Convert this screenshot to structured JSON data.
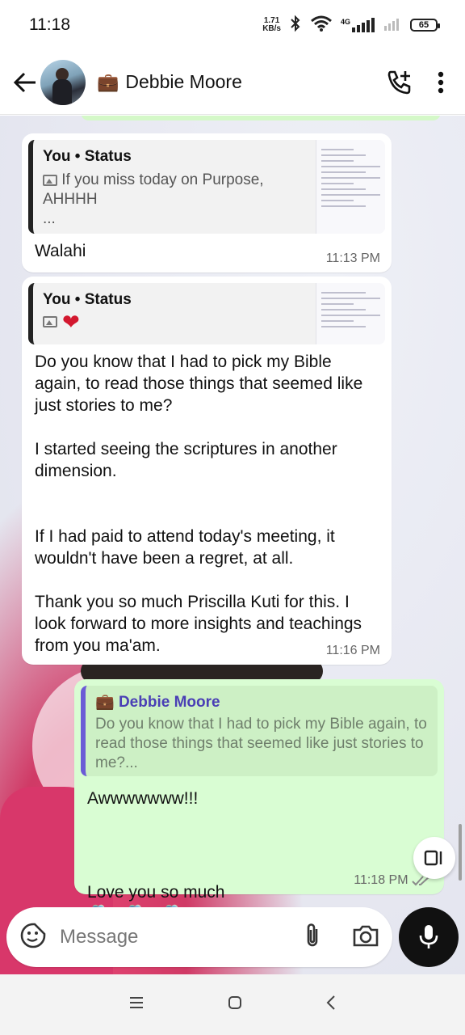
{
  "status_bar": {
    "time": "11:18",
    "net_speed_value": "1.71",
    "net_speed_unit": "KB/s",
    "network_type": "4G",
    "battery": "65"
  },
  "header": {
    "contact_emoji": "💼",
    "contact_name": "Debbie Moore"
  },
  "messages": [
    {
      "direction": "incoming",
      "quote_author": "You",
      "quote_source": "Status",
      "quote_text": "If you miss today on Purpose, AHHHH\n...",
      "body": "Walahi",
      "time": "11:13 PM"
    },
    {
      "direction": "incoming",
      "quote_author": "You",
      "quote_source": "Status",
      "quote_emoji": "❤",
      "body": "Do you know that I had to pick my Bible again, to read those things that seemed like just stories to me?\n\nI started seeing the scriptures in another dimension.\n\n\nIf I had paid to attend today's meeting, it wouldn't have been a regret, at all.\n\nThank you so much Priscilla Kuti for this. I look forward to more insights and teachings from you ma'am.",
      "time": "11:16 PM"
    },
    {
      "direction": "outgoing",
      "quote_emoji": "💼",
      "quote_author": "Debbie Moore",
      "quote_text": "Do you know that I had to pick my Bible again, to read those things that seemed like just stories to me?...",
      "body_line1": "Awwwwwww!!!",
      "body_line2": "Love you so much",
      "body_emoji": "🫂 🫂 🫂",
      "time": "11:18 PM",
      "status": "read"
    }
  ],
  "composer": {
    "placeholder": "Message"
  },
  "colors": {
    "outgoing_bubble": "#d9fdd3",
    "incoming_bubble": "#ffffff",
    "quote_bar_outgoing": "#6b5bd6",
    "read_ticks": "#8a8a8a"
  },
  "icons": [
    "back-arrow-icon",
    "add-call-icon",
    "more-vert-icon",
    "sticker-icon",
    "attach-icon",
    "camera-icon",
    "mic-icon",
    "switch-icon",
    "menu-icon",
    "home-icon",
    "back-nav-icon"
  ]
}
